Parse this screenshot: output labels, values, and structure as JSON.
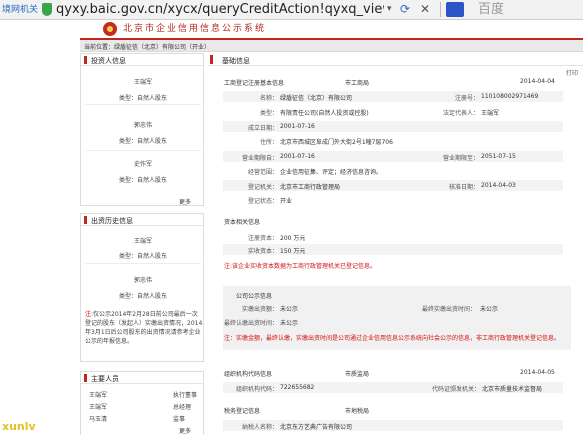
{
  "browser": {
    "prev_tab": "境网机关",
    "url": "qyxy.baic.gov.cn/xycx/queryCreditAction!qyxq_view.dhtml?r",
    "dropdown_glyph": "▾",
    "refresh_glyph": "⟳",
    "close_glyph": "✕",
    "search_engine": "百度"
  },
  "header": {
    "site_title": "北京市企业信用信息公示系统"
  },
  "breadcrumb": "当前位置：绿盾征信（北京）有限公司（开业）",
  "left": {
    "investors": {
      "title": "投资人信息",
      "items": [
        {
          "name": "王端军",
          "type": "类型：自然人股东"
        },
        {
          "name": "郭忠伟",
          "type": "类型：自然人股东"
        },
        {
          "name": "史作军",
          "type": "类型：自然人股东"
        }
      ],
      "more": "更多"
    },
    "history": {
      "title": "出资历史信息",
      "items": [
        {
          "name": "王端军",
          "type": "类型：自然人股东"
        },
        {
          "name": "郭忠伟",
          "type": "类型：自然人股东"
        }
      ],
      "note_prefix": "注:",
      "note": "仅公示2014年2月28日前公司最后一次登记的股东（发起人）实缴出资情况，2014年3月1日后公司股东的出资情况请参考企业公示的年报信息。"
    },
    "staff": {
      "title": "主要人员",
      "items": [
        {
          "name": "王端军",
          "role": "执行董事"
        },
        {
          "name": "王端军",
          "role": "总经理"
        },
        {
          "name": "马玉清",
          "role": "监事"
        }
      ],
      "more": "更多"
    }
  },
  "main": {
    "section_title": "基础信息",
    "reg": {
      "header_left": "工商登记注册基本信息",
      "header_mid": "市工商局",
      "header_date": "2014-04-04",
      "corner": "打印",
      "name_label": "名称：",
      "name_value": "绿盾征信（北京）有限公司",
      "regno_label": "注册号：",
      "regno_value": "110108002971469",
      "type_label": "类型：",
      "type_value": "有限责任公司(自然人投资或控股)",
      "legal_label": "法定代表人：",
      "legal_value": "王端军",
      "est_label": "成立日期：",
      "est_value": "2001-07-16",
      "addr_label": "住所：",
      "addr_value": "北京市西城区阜成门外大街2号1幢7层706",
      "from_label": "营业期限自：",
      "from_value": "2001-07-16",
      "to_label": "营业期限至：",
      "to_value": "2051-07-15",
      "scope_label": "经营范围：",
      "scope_value": "企业信用征集、评定；经济信息咨询。",
      "org_label": "登记机关：",
      "org_value": "北京市工商行政管理局",
      "approve_label": "核准日期：",
      "approve_value": "2014-04-03",
      "status_label": "登记状态：",
      "status_value": "开业"
    },
    "capital": {
      "header": "资本相关信息",
      "reg_cap_label": "注册资本：",
      "reg_cap_value": "200 万元",
      "paid_label": "实收资本：",
      "paid_value": "150 万元",
      "note": "注:该企业实收资本数据为工商行政管理机关已登记信息。"
    },
    "annual": {
      "header": "公司公示信息",
      "paid_label": "实缴出资额：",
      "paid_value": "未公示",
      "latest_label": "最终实缴出资时间：",
      "latest_value": "未公示",
      "sub_label": "最终认缴出资时间：",
      "sub_value": "未公示",
      "note": "注：实缴金额，最终认缴，实缴出资时间是公司通过企业信用信息公示系统向社会公示的信息，非工商行政管理机关登记信息。"
    },
    "orgcode": {
      "header_left": "组织机构代码信息",
      "header_mid": "市质监局",
      "header_date": "2014-04-05",
      "code_label": "组织机构代码：",
      "code_value": "722655682",
      "cert_label": "代码证颁发机关：",
      "cert_value": "北京市质量技术监督局"
    },
    "tax": {
      "header_left": "税务登记信息",
      "header_mid": "市地税局",
      "payer_label": "纳税人名称：",
      "payer_value": "北京东方艺典广告有限公司"
    }
  },
  "watermark": "xunlv"
}
